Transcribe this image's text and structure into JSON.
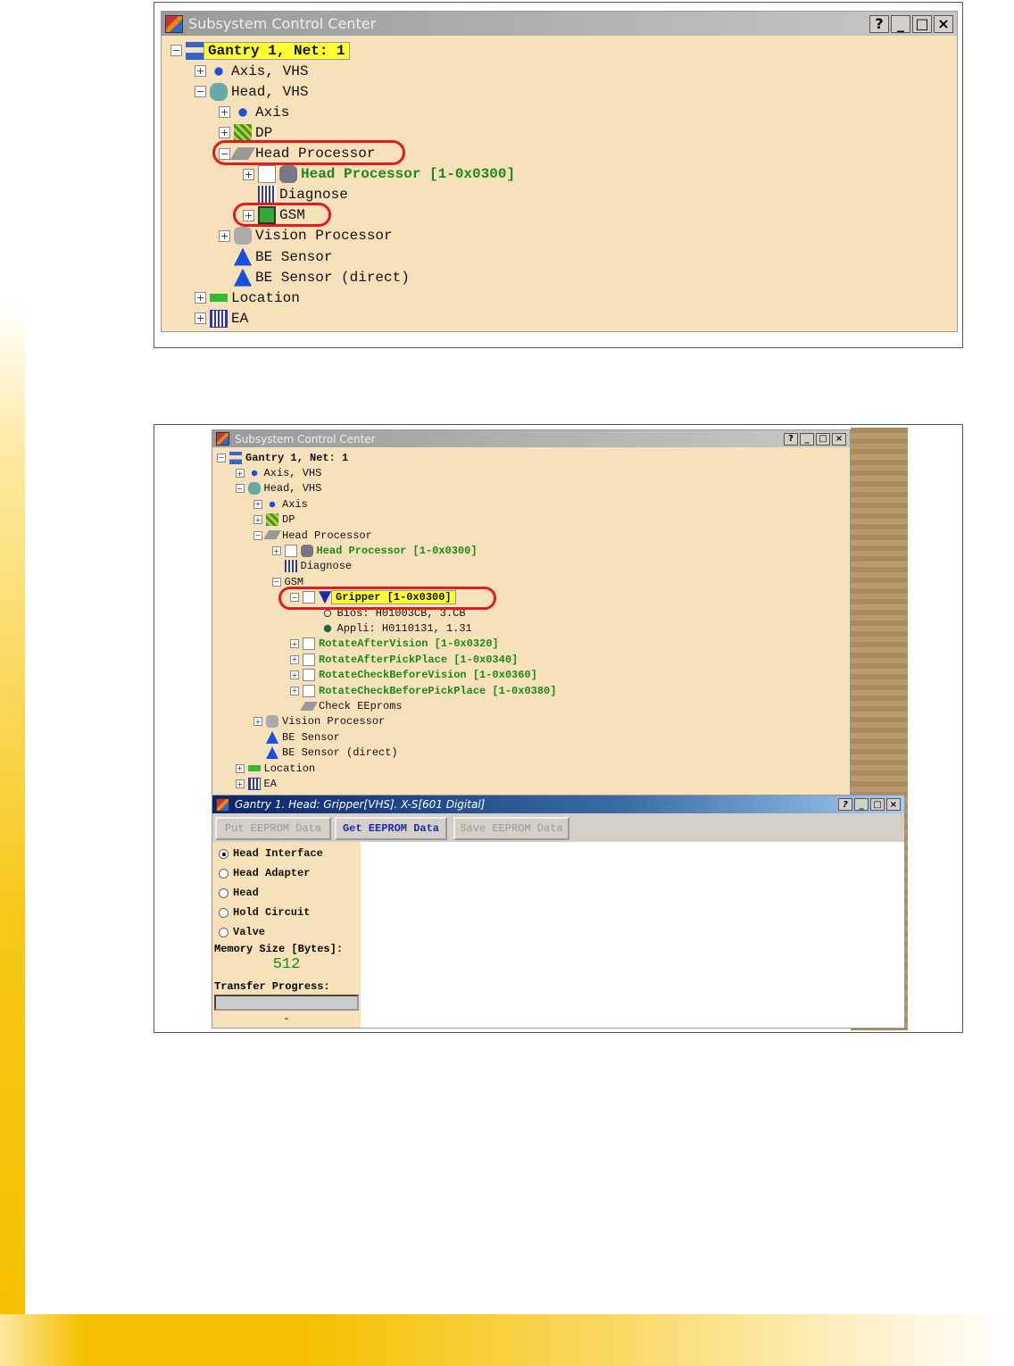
{
  "figure1": {
    "title": "Subsystem Control Center",
    "window_buttons": [
      "?",
      "_",
      "□",
      "×"
    ],
    "tree": [
      {
        "level": 0,
        "exp": "-",
        "icon": "tree-icon",
        "label": "Gantry 1, Net: 1",
        "style": "hl"
      },
      {
        "level": 1,
        "exp": "+",
        "icon": "axis-icon",
        "label": "Axis, VHS"
      },
      {
        "level": 1,
        "exp": "-",
        "icon": "head-icon",
        "label": "Head, VHS"
      },
      {
        "level": 2,
        "exp": "+",
        "icon": "axis-icon",
        "label": "Axis"
      },
      {
        "level": 2,
        "exp": "+",
        "icon": "dp-icon",
        "label": "DP"
      },
      {
        "level": 2,
        "exp": "-",
        "icon": "chip-icon",
        "label": "Head Processor"
      },
      {
        "level": 3,
        "exp": "+",
        "check": true,
        "icon": "module-icon",
        "label": "Head Processor [1-0x0300]",
        "style": "green"
      },
      {
        "level": 3,
        "exp": "",
        "icon": "diagnose-icon",
        "label": "Diagnose"
      },
      {
        "level": 3,
        "exp": "+",
        "icon": "gsm-icon",
        "label": "GSM"
      },
      {
        "level": 2,
        "exp": "+",
        "icon": "camera-icon",
        "label": "Vision Processor"
      },
      {
        "level": 2,
        "exp": "",
        "icon": "sensor-icon",
        "label": "BE Sensor"
      },
      {
        "level": 2,
        "exp": "",
        "icon": "sensor-icon",
        "label": "BE Sensor (direct)"
      },
      {
        "level": 1,
        "exp": "+",
        "icon": "location-icon",
        "label": "Location"
      },
      {
        "level": 1,
        "exp": "+",
        "icon": "ea-icon",
        "label": "EA"
      }
    ]
  },
  "figure2": {
    "title": "Subsystem Control Center",
    "window_buttons": [
      "?",
      "_",
      "□",
      "×"
    ],
    "tree": [
      {
        "level": 0,
        "exp": "-",
        "icon": "tree-icon",
        "label": "Gantry 1, Net: 1",
        "style": "bold"
      },
      {
        "level": 1,
        "exp": "+",
        "icon": "axis-icon",
        "label": "Axis, VHS"
      },
      {
        "level": 1,
        "exp": "-",
        "icon": "head-icon",
        "label": "Head, VHS"
      },
      {
        "level": 2,
        "exp": "+",
        "icon": "axis-icon",
        "label": "Axis"
      },
      {
        "level": 2,
        "exp": "+",
        "icon": "dp-icon",
        "label": "DP"
      },
      {
        "level": 2,
        "exp": "-",
        "icon": "chip-icon",
        "label": "Head Processor"
      },
      {
        "level": 3,
        "exp": "+",
        "check": true,
        "icon": "module-icon",
        "label": "Head Processor [1-0x0300]",
        "style": "green"
      },
      {
        "level": 3,
        "exp": "",
        "icon": "diagnose-icon",
        "label": "Diagnose"
      },
      {
        "level": 3,
        "exp": "-",
        "icon": "",
        "label": "GSM"
      },
      {
        "level": 4,
        "exp": "-",
        "check": true,
        "icon": "gripper-icon",
        "label": "Gripper [1-0x0300]",
        "style": "hl"
      },
      {
        "level": 5,
        "exp": "",
        "icon": "bios-dot-icon",
        "label": "Bios: H01003CB, 3.CB"
      },
      {
        "level": 5,
        "exp": "",
        "icon": "appli-dot-icon",
        "label": "Appli: H0110131, 1.31"
      },
      {
        "level": 4,
        "exp": "+",
        "check": true,
        "icon": "",
        "label": "RotateAfterVision [1-0x0320]",
        "style": "green"
      },
      {
        "level": 4,
        "exp": "+",
        "check": true,
        "icon": "",
        "label": "RotateAfterPickPlace [1-0x0340]",
        "style": "green"
      },
      {
        "level": 4,
        "exp": "+",
        "check": true,
        "icon": "",
        "label": "RotateCheckBeforeVision [1-0x0360]",
        "style": "green"
      },
      {
        "level": 4,
        "exp": "+",
        "check": true,
        "icon": "",
        "label": "RotateCheckBeforePickPlace [1-0x0380]",
        "style": "green"
      },
      {
        "level": 4,
        "exp": "",
        "icon": "chip-icon",
        "label": "Check EEproms"
      },
      {
        "level": 2,
        "exp": "+",
        "icon": "camera-icon",
        "label": "Vision Processor"
      },
      {
        "level": 2,
        "exp": "",
        "icon": "sensor-icon",
        "label": "BE Sensor"
      },
      {
        "level": 2,
        "exp": "",
        "icon": "sensor-icon",
        "label": "BE Sensor (direct)"
      },
      {
        "level": 1,
        "exp": "+",
        "icon": "location-icon",
        "label": "Location"
      },
      {
        "level": 1,
        "exp": "+",
        "icon": "ea-icon",
        "label": "EA"
      }
    ],
    "eeprom_window": {
      "title": "Gantry 1. Head: Gripper[VHS]. X-S[601 Digital]",
      "buttons": [
        "Put EEPROM Data",
        "Get EEPROM Data",
        "Save EEPROM Data"
      ],
      "options": [
        "Head Interface",
        "Head Adapter",
        "Head",
        "Hold Circuit",
        "Valve"
      ],
      "selected_option": "Head Interface",
      "memory_label": "Memory Size [Bytes]:",
      "memory_value": "512",
      "progress_label": "Transfer Progress:",
      "progress_fraction": 0,
      "progress_text": "-"
    }
  }
}
